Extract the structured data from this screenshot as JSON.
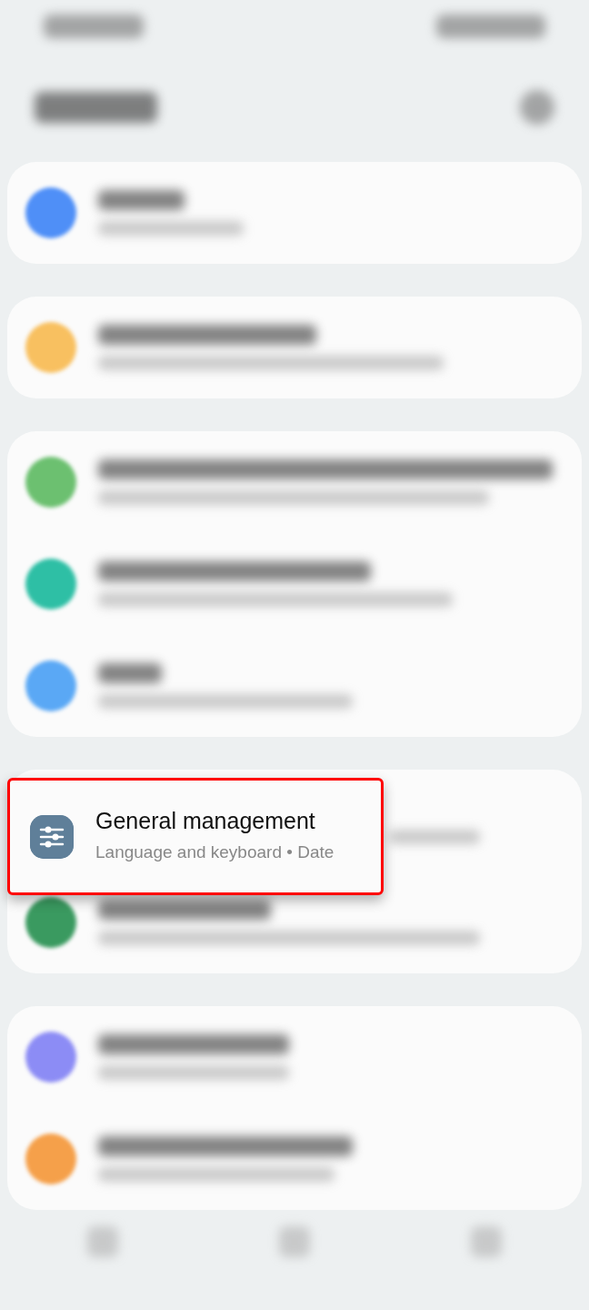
{
  "background_groups": [
    {
      "items": [
        {
          "kind": "row",
          "color": "#4f8ff7"
        }
      ]
    },
    {
      "items": [
        {
          "kind": "row",
          "color": "#f8c060"
        }
      ]
    },
    {
      "items": [
        {
          "kind": "row",
          "color": "#6cc070"
        },
        {
          "kind": "row",
          "color": "#2ebfa5"
        },
        {
          "kind": "row",
          "color": "#5aa8f5"
        }
      ]
    },
    {
      "items": [
        {
          "kind": "covered"
        },
        {
          "kind": "row",
          "color": "#3a9a60"
        }
      ]
    },
    {
      "items": [
        {
          "kind": "row",
          "color": "#8c8cf5"
        },
        {
          "kind": "row",
          "color": "#f5a04a"
        }
      ]
    }
  ],
  "highlighted_item": {
    "title": "General management",
    "subtitle": "Language and keyboard  •  Date"
  }
}
